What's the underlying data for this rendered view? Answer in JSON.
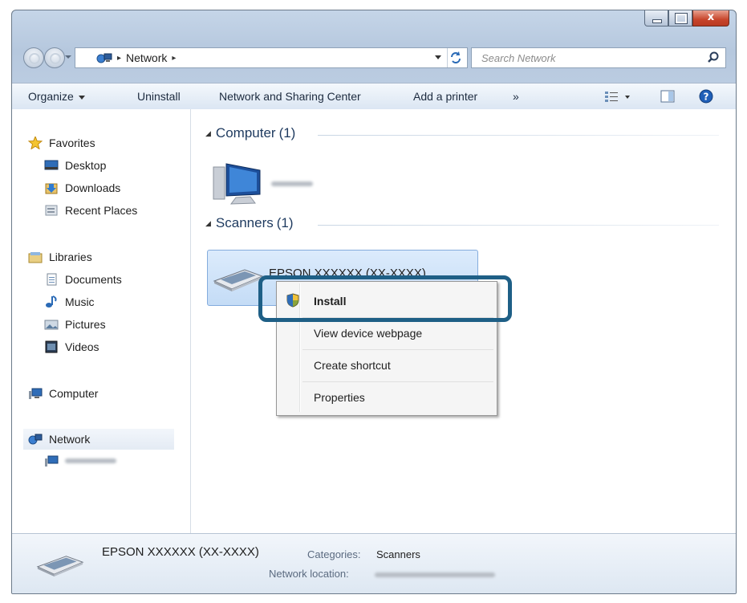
{
  "window": {
    "caption_close_glyph": "x"
  },
  "address_bar": {
    "crumb": "Network",
    "separator": "▸",
    "trailing_separator": "▸",
    "search_placeholder": "Search Network"
  },
  "toolbar": {
    "organize": "Organize",
    "uninstall": "Uninstall",
    "network_sharing_center": "Network and Sharing Center",
    "add_printer": "Add a printer",
    "more": "»"
  },
  "nav_pane": {
    "favorites": "Favorites",
    "desktop": "Desktop",
    "downloads": "Downloads",
    "recent_places": "Recent Places",
    "libraries": "Libraries",
    "documents": "Documents",
    "music": "Music",
    "pictures": "Pictures",
    "videos": "Videos",
    "computer": "Computer",
    "network": "Network"
  },
  "content": {
    "groups": [
      {
        "name": "Computer",
        "count": "(1)"
      },
      {
        "name": "Scanners",
        "count": "(1)"
      }
    ],
    "scanner_name": "EPSON XXXXXX (XX-XXXX)"
  },
  "context_menu": {
    "items": [
      "Install",
      "View device webpage",
      "Create shortcut",
      "Properties"
    ]
  },
  "details_pane": {
    "device_name": "EPSON XXXXXX (XX-XXXX)",
    "categories_label": "Categories:",
    "categories_value": "Scanners",
    "network_location_label": "Network location:"
  },
  "colors": {
    "highlight_frame": "#1e5f86",
    "selection": "#c4dcf6"
  },
  "icons": [
    "network-icon",
    "search-icon",
    "star-icon",
    "desktop-icon",
    "downloads-icon",
    "recent-places-icon",
    "libraries-icon",
    "documents-icon",
    "music-icon",
    "pictures-icon",
    "videos-icon",
    "computer-icon",
    "scanner-icon",
    "uac-shield-icon",
    "help-icon",
    "preview-pane-icon",
    "view-options-icon"
  ]
}
